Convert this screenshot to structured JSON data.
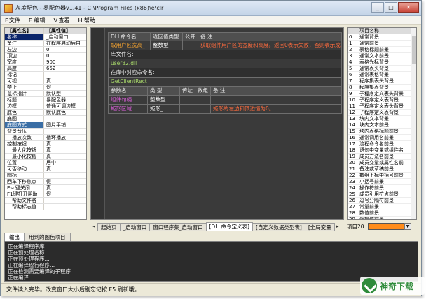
{
  "window": {
    "title": "灰度配色 - 易配色器v1.41 - C:\\Program Files (x86)\\e\\clr"
  },
  "menu": [
    "F.文件",
    "E.编辑",
    "V.查看",
    "H.帮助"
  ],
  "props": {
    "header": [
      "【属性名】",
      "【属性值】"
    ],
    "rows": [
      {
        "k": "名称",
        "v": "_启动窗口",
        "style": "selected"
      },
      {
        "k": "备注",
        "v": "在程序启动后自",
        "style": ""
      },
      {
        "k": "左边",
        "v": "0",
        "style": ""
      },
      {
        "k": "顶边",
        "v": "0",
        "style": ""
      },
      {
        "k": "宽度",
        "v": "900",
        "style": ""
      },
      {
        "k": "高度",
        "v": "652",
        "style": ""
      },
      {
        "k": "标记",
        "v": "",
        "style": ""
      },
      {
        "k": "可视",
        "v": "真",
        "style": ""
      },
      {
        "k": "禁止",
        "v": "假",
        "style": ""
      },
      {
        "k": "鼠标指针",
        "v": "默认型",
        "style": ""
      },
      {
        "k": "标题",
        "v": "易配色器",
        "style": ""
      },
      {
        "k": "边框",
        "v": "普通可调边框",
        "style": ""
      },
      {
        "k": "底色",
        "v": "默认底色",
        "style": ""
      },
      {
        "k": "底图",
        "v": "",
        "style": ""
      },
      {
        "k": "底图方式",
        "v": "图片平铺",
        "style": "blue"
      },
      {
        "k": "背景音乐",
        "v": "",
        "style": ""
      },
      {
        "k": "播放次数",
        "v": "循环播放",
        "style": "indent"
      },
      {
        "k": "控制按钮",
        "v": "真",
        "style": ""
      },
      {
        "k": "最大化按钮",
        "v": "真",
        "style": "indent"
      },
      {
        "k": "最小化按钮",
        "v": "真",
        "style": "indent"
      },
      {
        "k": "位置",
        "v": "居中",
        "style": ""
      },
      {
        "k": "可否移动",
        "v": "真",
        "style": ""
      },
      {
        "k": "图标",
        "v": "",
        "style": ""
      },
      {
        "k": "回车下移焦点",
        "v": "假",
        "style": ""
      },
      {
        "k": "Esc键关闭",
        "v": "真",
        "style": ""
      },
      {
        "k": "F1键打开帮助",
        "v": "假",
        "style": ""
      },
      {
        "k": "帮助文件名",
        "v": "",
        "style": "indent"
      },
      {
        "k": "帮助标志值",
        "v": "",
        "style": "indent"
      }
    ]
  },
  "dll": {
    "header1": [
      "DLL命令名",
      "返回值类型",
      "公开",
      "备 注"
    ],
    "row1": [
      "取用户区宽高_",
      "整数型",
      "",
      "获取组件用户区的宽度和高度。返回0表示失败，否则表示成功"
    ],
    "lib_label": "库文件名:",
    "lib_value": "user32.dll",
    "entry_label": "在库中对应命令名:",
    "entry_value": "GetClientRect",
    "header2": [
      "参数名",
      "类 型",
      "传址",
      "数组",
      "备 注"
    ],
    "params": [
      [
        "组件句柄",
        "整数型",
        "",
        "",
        ""
      ],
      [
        "矩形区域",
        "矩形_",
        "",
        "",
        "矩形的左边和顶边恒为0。"
      ]
    ]
  },
  "tabs": {
    "items": [
      "起始页",
      "_启动窗口",
      "窗口程序集_启动窗口",
      "[DLL命令定义表]",
      "[自定义数据类型表]",
      "[全局变量"
    ],
    "active_index": 3
  },
  "right_list": {
    "header": "项目名称",
    "items": [
      "项目名称",
      "通常背景",
      "通常前景",
      "表格标题前景",
      "通常文本前景",
      "表格光标背景",
      "通常表头背景",
      "通常表格背景",
      "程序集表头背景",
      "程序集表背景",
      "子程序定义表头背景",
      "子程序定义表背景",
      "子程序定义表头背景",
      "子程序定义表背景",
      "块内文本背景",
      "块内文本前景",
      "块内表格标题前景",
      "通常调用名前景",
      "流程命令名前景",
      "语句中变量或组件名",
      "成员方法名前景",
      "成员变量或属性名前",
      "备注或草稿前景",
      "数组下标中括号前景",
      "小括号前景",
      "操作符前景",
      "成员引用符点前景",
      "逗号分隔符前景",
      "常量前景",
      "数值前景",
      "逻辑值前景",
      "日期时间前景"
    ]
  },
  "project": {
    "label": "项目20:",
    "color": "#ff8c1a"
  },
  "bottom_tabs": [
    "输出",
    "用到的图色项目"
  ],
  "output": [
    "正在编译程序库",
    "正在预处理名称...",
    "正在预处理程序...",
    "正在编译现行程序...",
    "正在检测需要编译的子程序",
    "正在编译..."
  ],
  "status": "文件读入完毕。改变窗口大小后别忘记按 F5 刷新哦。",
  "watermark": "神奇下载"
}
